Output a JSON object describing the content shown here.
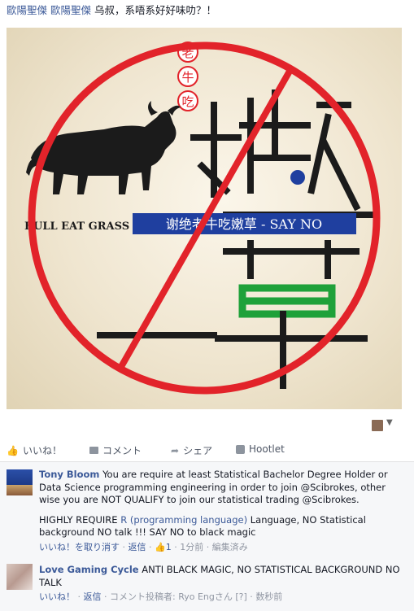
{
  "post": {
    "tag1": "歐陽聖傑",
    "tag2": "歐陽聖傑",
    "message": "乌叔，系唔系好好味叻？！"
  },
  "image": {
    "badge_chars": [
      "老",
      "牛",
      "吃"
    ],
    "big_char_top": "嫩",
    "big_char_bottom": "草",
    "bull_caption": "BULL EAT GRASS",
    "banner": "谢绝老牛吃嫩草 - SAY NO",
    "colors": {
      "prohibit_red": "#e2232a",
      "banner_blue": "#1f3f9f",
      "grass_green": "#1fa13a"
    }
  },
  "actions": {
    "like": "いいね！",
    "comment": "コメント",
    "share": "シェア",
    "hootlet": "Hootlet"
  },
  "comments": [
    {
      "author": "Tony Bloom",
      "text1": "You are require at least Statistical Bachelor Degree Holder or Data Science programming engineering in order to join @Scibrokes, other wise you are NOT QUALIFY to join our statistical trading @Scibrokes.",
      "text2_pre": "HIGHLY REQUIRE ",
      "text2_link": "R (programming language)",
      "text2_post": " Language, NO Statistical background NO talk !!! SAY NO to black magic",
      "unlike": "いいね！を取り消す",
      "reply": "返信",
      "likes": "1",
      "time": "1分前",
      "edited": "編集済み"
    },
    {
      "author": "Love Gaming Cycle",
      "text1": "ANTI BLACK MAGIC, NO STATISTICAL BACKGROUND NO TALK",
      "like": "いいね！",
      "reply": "返信",
      "posted_by": "コメント投稿者: Ryo Engさん",
      "help": "[?]",
      "time": "数秒前"
    }
  ]
}
